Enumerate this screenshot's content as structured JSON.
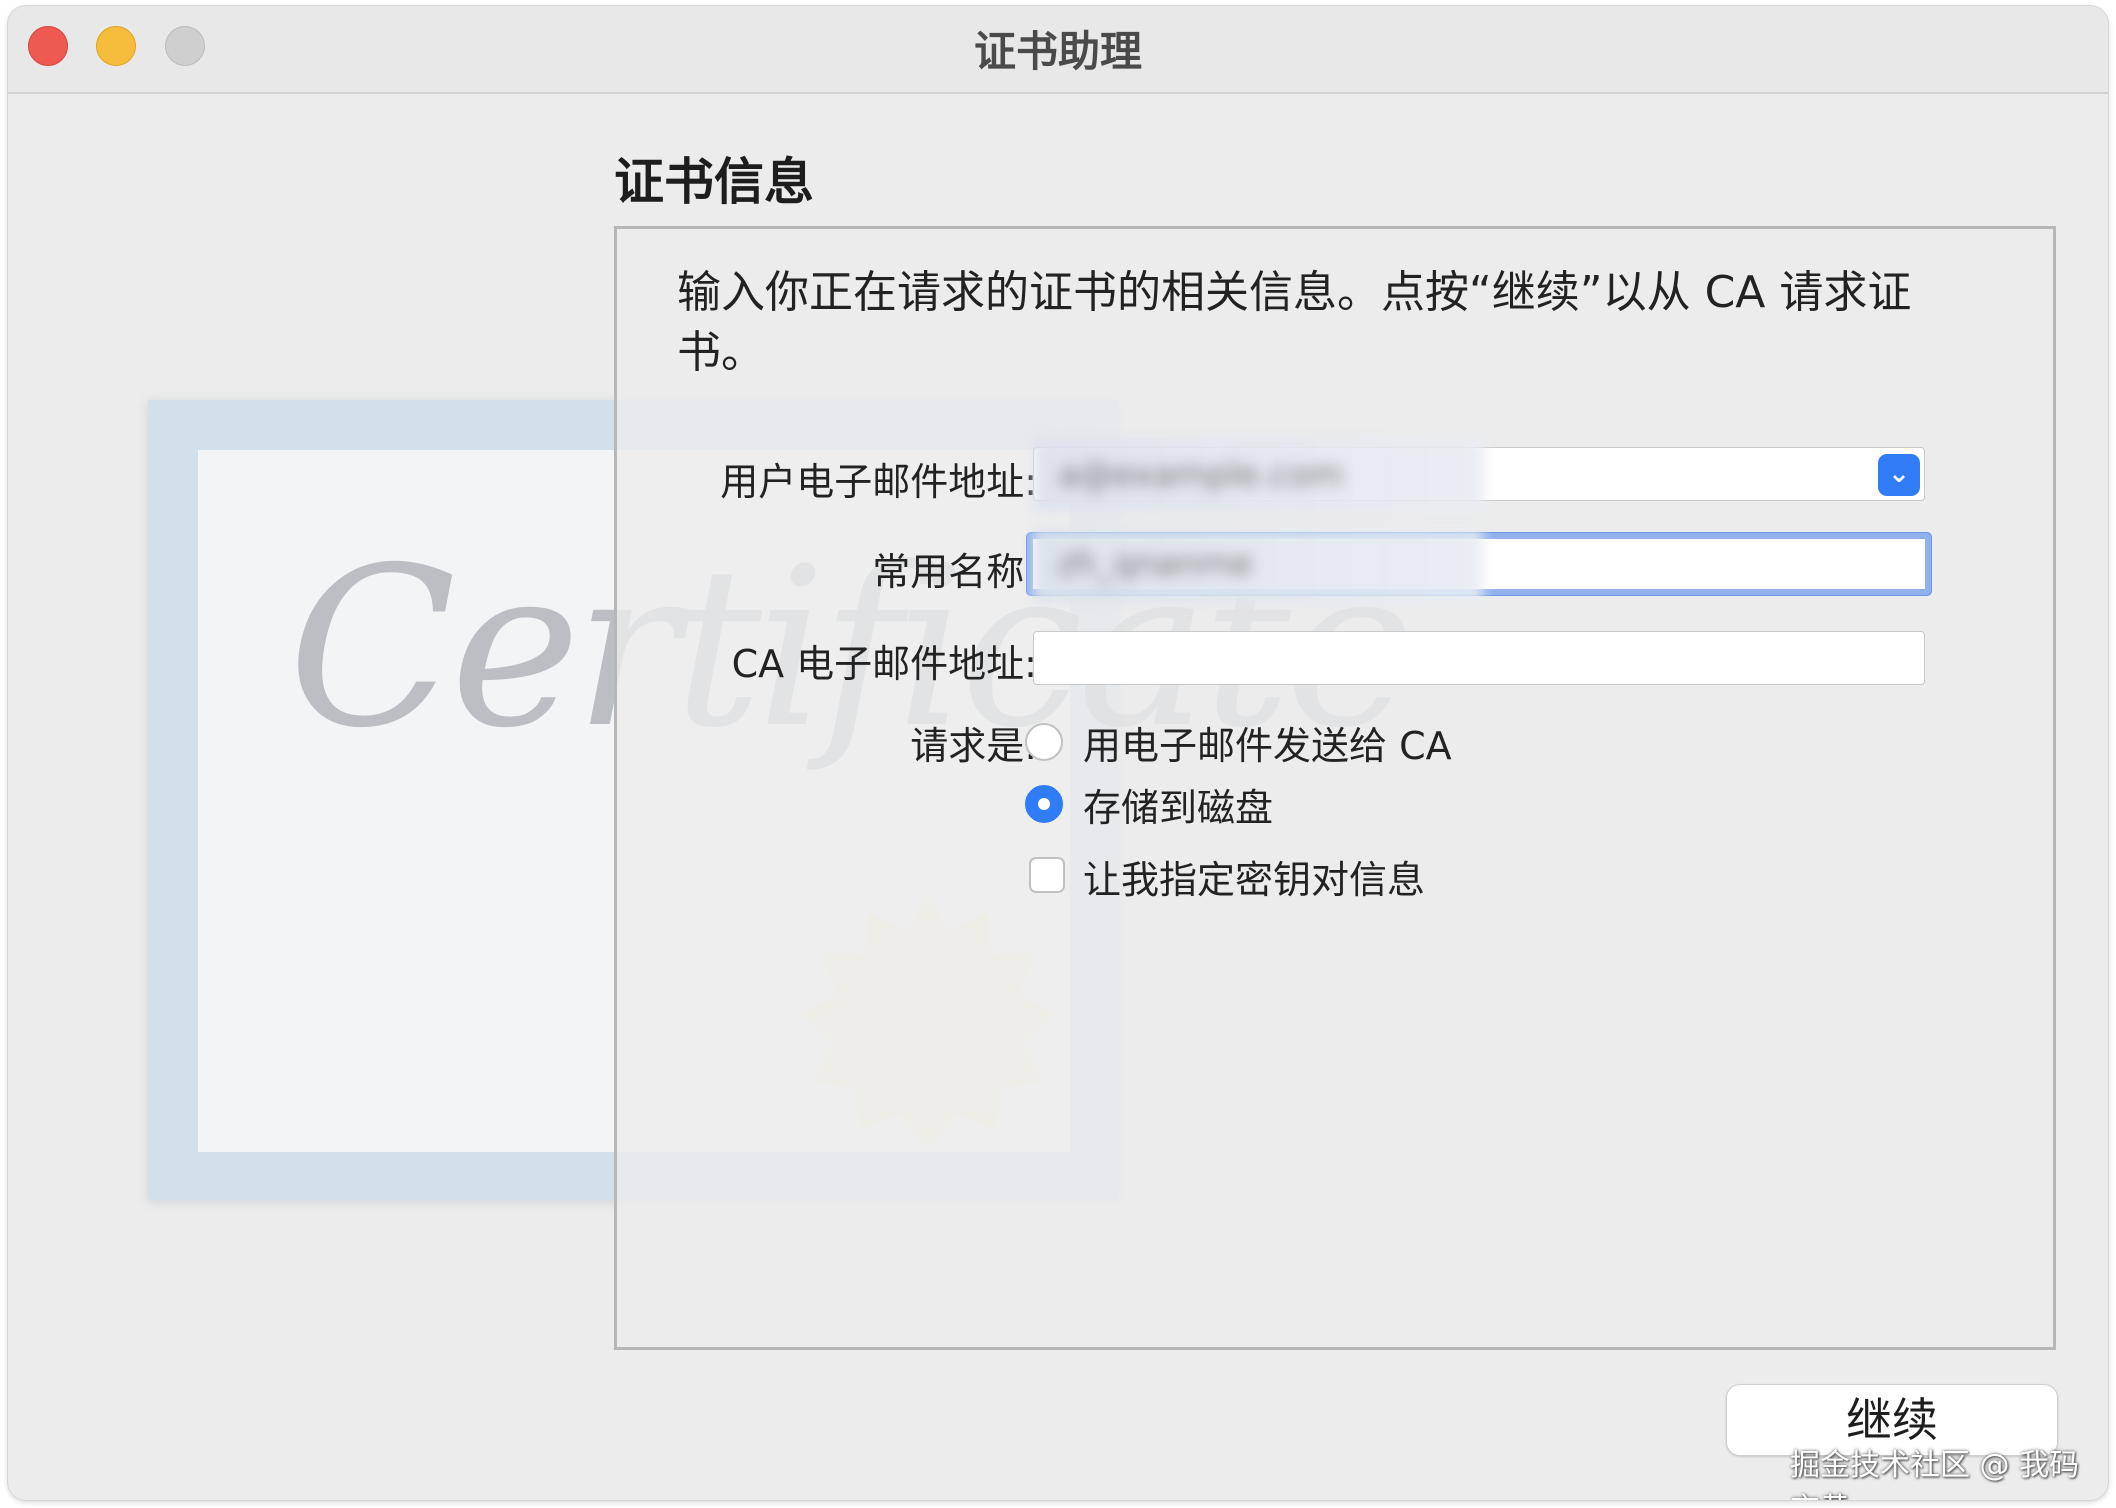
{
  "window": {
    "title": "证书助理"
  },
  "section": {
    "title": "证书信息"
  },
  "intro": "输入你正在请求的证书的相关信息。点按“继续”以从 CA 请求证书。",
  "illustration": {
    "script_text": "Certificate"
  },
  "form": {
    "email_label": "用户电子邮件地址:",
    "email_value": "a@example.com",
    "name_label": "常用名称:",
    "name_value": "zh_qnanme",
    "ca_email_label": "CA 电子邮件地址:",
    "ca_email_value": "",
    "request_label": "请求是:",
    "options": [
      {
        "label": "用电子邮件发送给 CA",
        "selected": false
      },
      {
        "label": "存储到磁盘",
        "selected": true
      }
    ],
    "keypair_label": "让我指定密钥对信息",
    "keypair_checked": false
  },
  "buttons": {
    "continue": "继续"
  },
  "watermark": "掘金技术社区 @ 我码玄黄",
  "colors": {
    "accent": "#2f7cf6",
    "close": "#ee5a52",
    "minimize": "#f5bd3b",
    "zoom": "#cfcfcf"
  }
}
